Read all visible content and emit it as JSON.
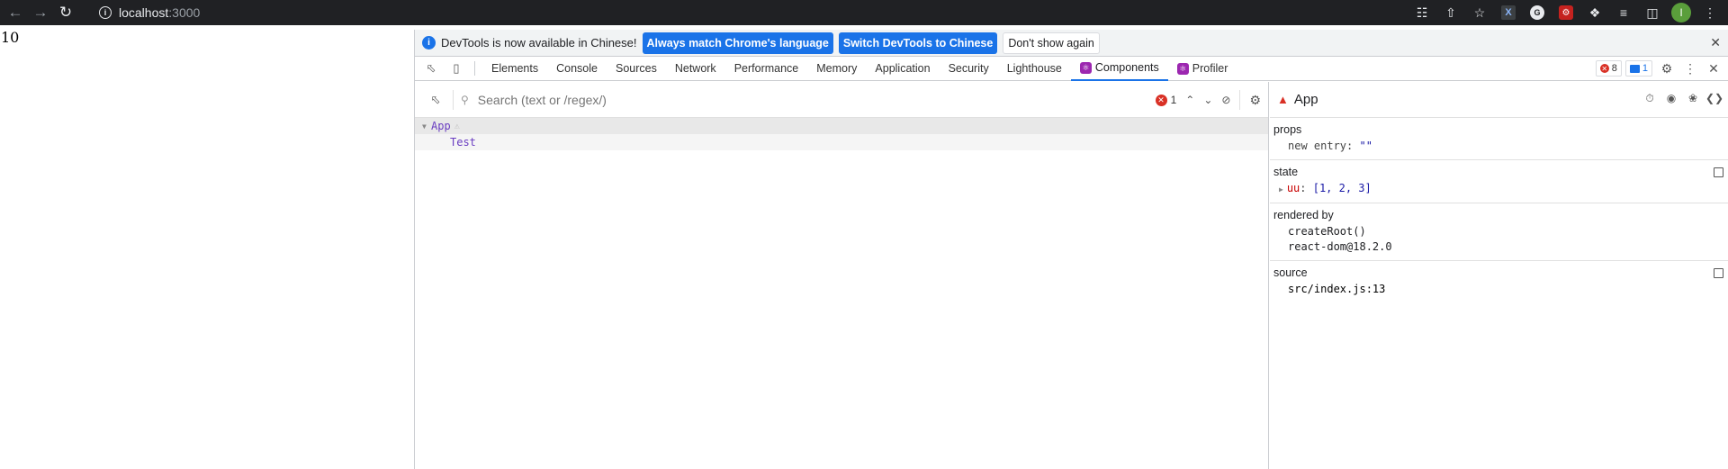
{
  "browser": {
    "url_host": "localhost",
    "url_port": ":3000",
    "avatar_letter": "I"
  },
  "page": {
    "count_text": "10"
  },
  "infobar": {
    "message": "DevTools is now available in Chinese!",
    "btn_match": "Always match Chrome's language",
    "btn_switch": "Switch DevTools to Chinese",
    "btn_dismiss": "Don't show again"
  },
  "tabs": [
    {
      "label": "Elements"
    },
    {
      "label": "Console"
    },
    {
      "label": "Sources"
    },
    {
      "label": "Network"
    },
    {
      "label": "Performance"
    },
    {
      "label": "Memory"
    },
    {
      "label": "Application"
    },
    {
      "label": "Security"
    },
    {
      "label": "Lighthouse"
    },
    {
      "label": "Components"
    },
    {
      "label": "Profiler"
    }
  ],
  "issues": {
    "errors": "8",
    "messages": "1"
  },
  "search": {
    "placeholder": "Search (text or /regex/)",
    "error_count": "1"
  },
  "tree": {
    "root": "App",
    "child": "Test"
  },
  "inspector": {
    "title": "App",
    "props_title": "props",
    "prop_key": "new entry",
    "prop_value": "\"\"",
    "state_title": "state",
    "state_key": "uu",
    "state_value": "[1, 2, 3]",
    "rendered_title": "rendered by",
    "rendered_items": [
      "createRoot()",
      "react-dom@18.2.0"
    ],
    "source_title": "source",
    "source_value": "src/index.js:13"
  }
}
